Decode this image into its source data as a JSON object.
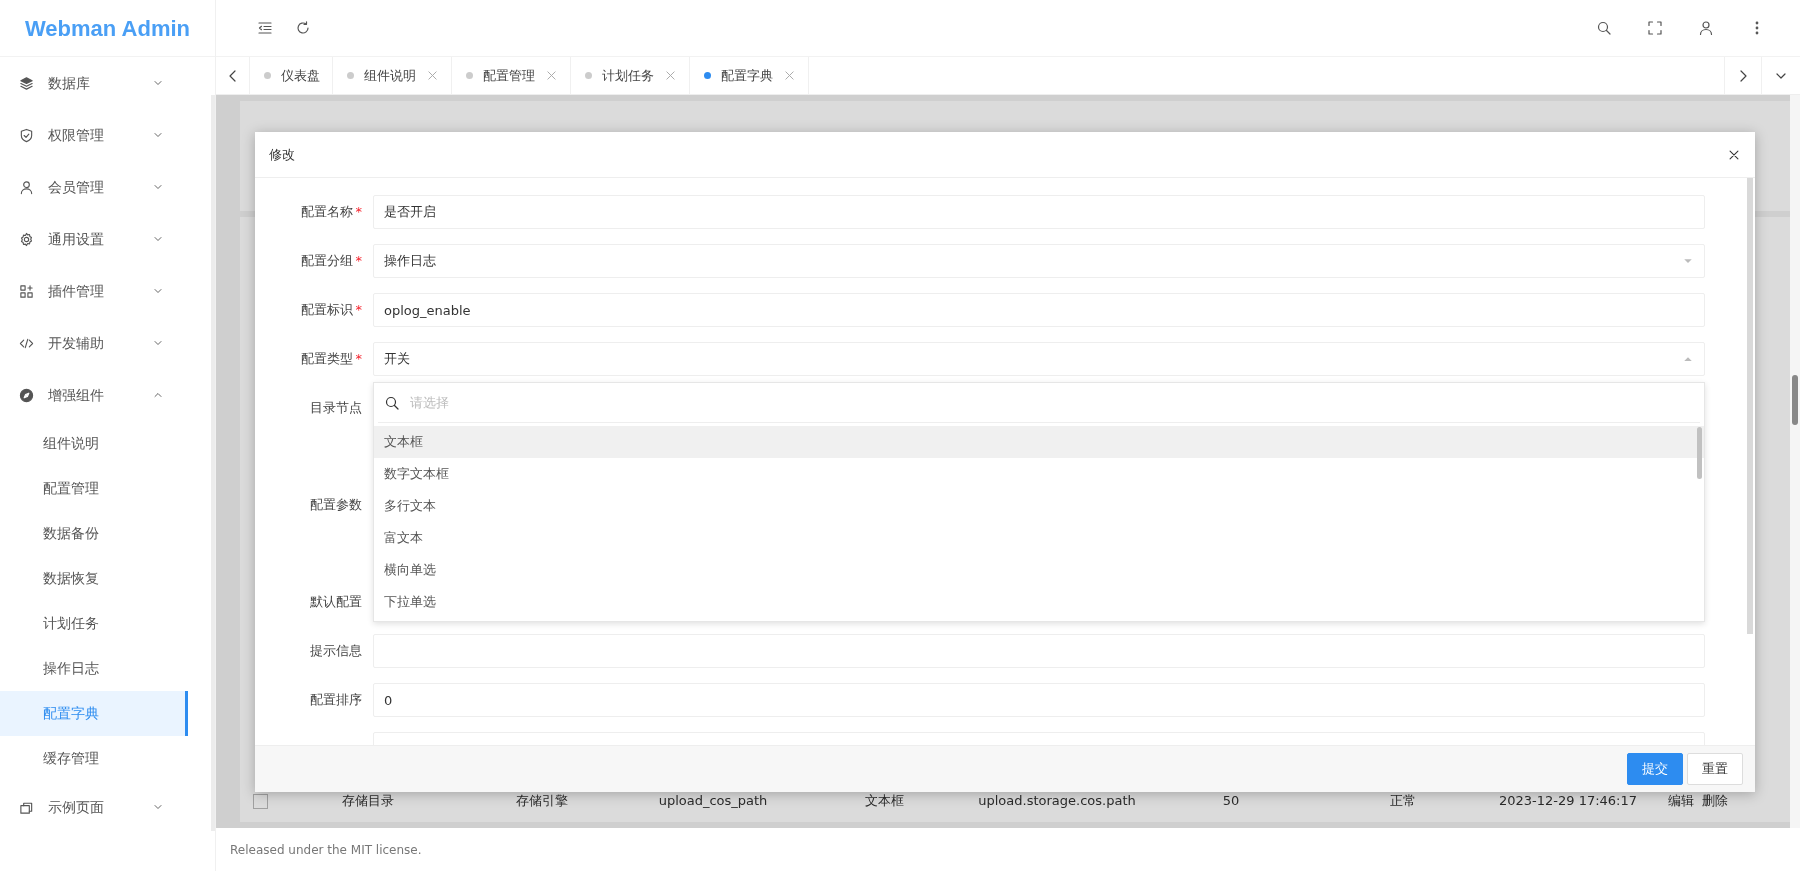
{
  "sidebar": {
    "logo": "Webman Admin",
    "items": [
      {
        "label": "数据库",
        "expanded": false
      },
      {
        "label": "权限管理",
        "expanded": false
      },
      {
        "label": "会员管理",
        "expanded": false
      },
      {
        "label": "通用设置",
        "expanded": false
      },
      {
        "label": "插件管理",
        "expanded": false
      },
      {
        "label": "开发辅助",
        "expanded": false
      },
      {
        "label": "增强组件",
        "expanded": true,
        "children": [
          {
            "label": "组件说明",
            "selected": false
          },
          {
            "label": "配置管理",
            "selected": false
          },
          {
            "label": "数据备份",
            "selected": false
          },
          {
            "label": "数据恢复",
            "selected": false
          },
          {
            "label": "计划任务",
            "selected": false
          },
          {
            "label": "操作日志",
            "selected": false
          },
          {
            "label": "配置字典",
            "selected": true
          },
          {
            "label": "缓存管理",
            "selected": false
          }
        ]
      },
      {
        "label": "示例页面",
        "expanded": false
      }
    ]
  },
  "tabs": [
    {
      "label": "仪表盘",
      "selected": false,
      "closable": false
    },
    {
      "label": "组件说明",
      "selected": false,
      "closable": true
    },
    {
      "label": "配置管理",
      "selected": false,
      "closable": true
    },
    {
      "label": "计划任务",
      "selected": false,
      "closable": true
    },
    {
      "label": "配置字典",
      "selected": true,
      "closable": true
    }
  ],
  "dialog": {
    "title": "修改",
    "fields": [
      {
        "label": "配置名称",
        "required_mark": "*",
        "kind": "text",
        "value": "是否开启"
      },
      {
        "label": "配置分组",
        "required_mark": "*",
        "kind": "select",
        "value": "操作日志",
        "open": false
      },
      {
        "label": "配置标识",
        "required_mark": "*",
        "kind": "text",
        "value": "oplog_enable"
      },
      {
        "label": "配置类型",
        "required_mark": "*",
        "kind": "select",
        "value": "开关",
        "open": true
      },
      {
        "label": "目录节点",
        "kind": "text"
      },
      {
        "label": "配置参数",
        "kind": "textarea"
      },
      {
        "label": "默认配置",
        "kind": "text"
      },
      {
        "label": "提示信息",
        "kind": "text"
      },
      {
        "label": "配置排序",
        "kind": "text",
        "value": "0"
      },
      {
        "kind": "text"
      }
    ],
    "dropdown": {
      "search_placeholder": "请选择",
      "options": [
        {
          "label": "文本框",
          "selected": true
        },
        {
          "label": "数字文本框",
          "selected": false
        },
        {
          "label": "多行文本",
          "selected": false
        },
        {
          "label": "富文本",
          "selected": false
        },
        {
          "label": "横向单选",
          "selected": false
        },
        {
          "label": "下拉单选",
          "selected": false
        }
      ]
    },
    "buttons": [
      {
        "label": "提交",
        "kind": "primary"
      },
      {
        "label": "重置",
        "kind": "default"
      }
    ]
  },
  "table": {
    "rows": [
      {
        "checked": false,
        "cells": [
          "存储目录",
          "存储引擎",
          "upload_cos_path",
          "文本框",
          "upload.storage.cos.path",
          "50",
          "正常",
          "2023-12-29 17:46:17"
        ],
        "actions": [
          "编辑",
          "删除"
        ]
      }
    ]
  },
  "footer": "Released under the MIT license."
}
